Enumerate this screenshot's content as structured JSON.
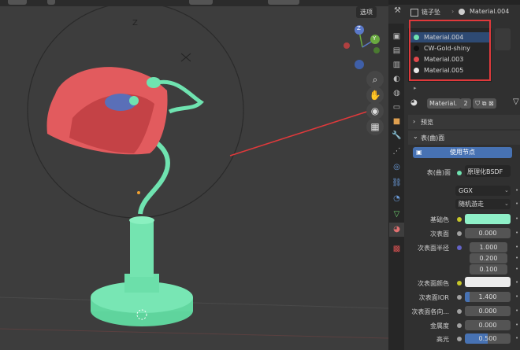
{
  "viewport": {
    "options_label": "选项",
    "axis_labels": {
      "y_green": "Y",
      "z_blue": "Z"
    },
    "gizmo_letters": {
      "z": "Z",
      "x": "X"
    },
    "nav_icons": [
      "zoom-icon",
      "hand-pan-icon",
      "camera-icon",
      "grid-icon"
    ]
  },
  "props": {
    "breadcrumb": {
      "object": "链子坠",
      "separator": "›",
      "material": "Material.004"
    },
    "slots": [
      {
        "name": "Material.004",
        "color": "#6fe3b0",
        "selected": true
      },
      {
        "name": "CW-Gold-shiny",
        "color": "#101010",
        "selected": false
      },
      {
        "name": "Material.003",
        "color": "#e0484c",
        "selected": false
      },
      {
        "name": "Material.005",
        "color": "#e8e8e8",
        "selected": false
      }
    ],
    "material_field": "Material.",
    "user_count": "2",
    "sections": {
      "preview": "预览",
      "surface": "表(曲)面"
    },
    "use_nodes": "使用节点",
    "surface_label": "表(曲)面",
    "surface_value": "原理化BSDF",
    "distribution": "GGX",
    "subsurface_method": "随机游走",
    "rows": [
      {
        "label": "基础色",
        "value": "",
        "kind": "color",
        "swatch": "#8ff0c8"
      },
      {
        "label": "次表面",
        "value": "0.000",
        "kind": "num"
      },
      {
        "label": "次表面半径",
        "value": "1.000",
        "kind": "num"
      },
      {
        "label": "",
        "value": "0.200",
        "kind": "num"
      },
      {
        "label": "",
        "value": "0.100",
        "kind": "num"
      },
      {
        "label": "次表面颜色",
        "value": "",
        "kind": "color",
        "swatch": "#ececec"
      },
      {
        "label": "次表面IOR",
        "value": "1.400",
        "kind": "num"
      },
      {
        "label": "次表面各向...",
        "value": "0.000",
        "kind": "num"
      },
      {
        "label": "金属度",
        "value": "0.000",
        "kind": "num"
      },
      {
        "label": "高光",
        "value": "0.500",
        "kind": "num"
      }
    ],
    "accent": "#4772b3"
  }
}
